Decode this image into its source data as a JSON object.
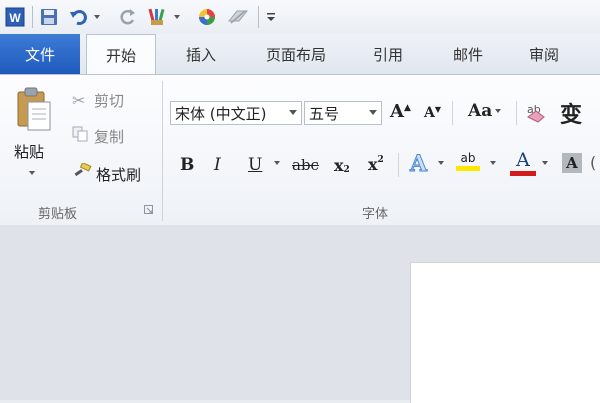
{
  "quick_access": {
    "app_icon": "word-app-icon",
    "save_icon": "save-icon",
    "undo_icon": "undo-icon",
    "redo_icon": "redo-icon",
    "format_painter_icon": "paintbrush-icon",
    "color_icon": "color-wheel-icon",
    "eraser_icon": "eraser-icon",
    "customize_icon": "customize-arrow-icon"
  },
  "tabs": [
    {
      "label": "文件"
    },
    {
      "label": "开始"
    },
    {
      "label": "插入"
    },
    {
      "label": "页面布局"
    },
    {
      "label": "引用"
    },
    {
      "label": "邮件"
    },
    {
      "label": "审阅"
    }
  ],
  "clipboard": {
    "paste_label": "粘贴",
    "cut_label": "剪切",
    "copy_label": "复制",
    "format_painter_label": "格式刷",
    "group_label": "剪贴板"
  },
  "font": {
    "font_name": "宋体 (中文正)",
    "font_size": "五号",
    "grow_label": "A",
    "shrink_label": "A",
    "change_case_label": "Aa",
    "bold_label": "B",
    "italic_label": "I",
    "underline_label": "U",
    "strike_label": "abc",
    "subscript_label": "x",
    "superscript_label": "x",
    "sub_mark": "2",
    "sup_mark": "2",
    "text_effect_label": "A",
    "highlight_label": "ab",
    "font_color_label": "A",
    "shading_label": "A",
    "phonetic_label": "变",
    "group_label": "字体"
  },
  "colors": {
    "file_tab": "#2a66c9",
    "highlight": "#ffe600",
    "font_color": "#d21b1b"
  }
}
